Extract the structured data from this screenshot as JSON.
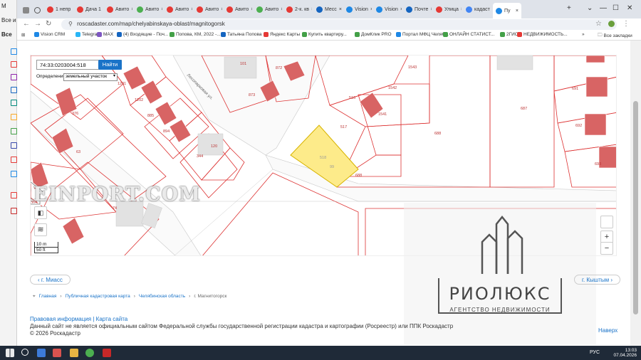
{
  "outer_window": {
    "items": [
      "M",
      "Все и",
      "Все"
    ]
  },
  "tabs": [
    {
      "label": "1 непр",
      "color": "#e53935"
    },
    {
      "label": "Дача 1",
      "color": "#e53935"
    },
    {
      "label": "Авито",
      "color": "#e53935"
    },
    {
      "label": "Авито",
      "color": "#4caf50"
    },
    {
      "label": "Авито",
      "color": "#e53935"
    },
    {
      "label": "Авито",
      "color": "#e53935"
    },
    {
      "label": "Авито",
      "color": "#e53935"
    },
    {
      "label": "Авито",
      "color": "#4caf50"
    },
    {
      "label": "2-к. кв",
      "color": "#e53935"
    },
    {
      "label": "Месс",
      "color": "#1565c0"
    },
    {
      "label": "Vision",
      "color": "#1e88e5"
    },
    {
      "label": "Vision",
      "color": "#1e88e5"
    },
    {
      "label": "Почте",
      "color": "#1565c0"
    },
    {
      "label": "Улица",
      "color": "#e53935"
    },
    {
      "label": "кадаст",
      "color": "#4285f4"
    },
    {
      "label": "Пу",
      "color": "#1e88e5"
    }
  ],
  "address_bar": {
    "url": "roscadaster.com/map/chelyabinskaya-oblast/magnitogorsk"
  },
  "bookmarks": [
    {
      "label": "Vision CRM",
      "color": "#1e88e5"
    },
    {
      "label": "Telegram",
      "color": "#29b6f6"
    },
    {
      "label": "MAX",
      "color": "#7e57c2"
    },
    {
      "label": "(4) Входящие - Поч...",
      "color": "#1565c0"
    },
    {
      "label": "Попова, КМ, 2022 -...",
      "color": "#43a047"
    },
    {
      "label": "Татьяна Попова",
      "color": "#1565c0"
    },
    {
      "label": "Яндекс Карты",
      "color": "#e53935"
    },
    {
      "label": "Купить квартиру...",
      "color": "#43a047"
    },
    {
      "label": "ДомКлик PRO",
      "color": "#43a047"
    },
    {
      "label": "Портал МФЦ Челяб...",
      "color": "#1e88e5"
    },
    {
      "label": "ОНЛАЙН СТАТИСТ...",
      "color": "#43a047"
    },
    {
      "label": "2ГИС",
      "color": "#43a047"
    },
    {
      "label": "НЕДВИЖИМОСТЬ...",
      "color": "#e53935"
    }
  ],
  "bookmarks_folder": "Все закладки",
  "map": {
    "search_value": "74:33:0203004:518",
    "find_label": "Найти",
    "mode_label": "Определение",
    "mode_value": "земельный участок",
    "zoom_in": "+",
    "zoom_out": "−",
    "scale_m": "10 m",
    "scale_ft": "50 ft",
    "street": "Лесопарковая ул.",
    "parcels": [
      "101",
      "872",
      "873",
      "1543",
      "1542",
      "516",
      "1541",
      "517",
      "687",
      "688",
      "691",
      "692",
      "693",
      "376",
      "1201",
      "1202",
      "885",
      "894",
      "344",
      "120",
      "63",
      "518",
      "99",
      "364",
      "74",
      "688"
    ],
    "watermark": "REINPORT.COM"
  },
  "pager": {
    "prev": "г. Миасс",
    "next": "г. Кыштым"
  },
  "breadcrumb": [
    "Главная",
    "Публичная кадастровая карта",
    "Челябинская область",
    "г. Магнитогорск"
  ],
  "footer": {
    "legal": "Правовая информация",
    "sep": " | ",
    "sitemap": "Карта сайта",
    "disclaimer": "Данный сайт не является официальным сайтом Федеральной службы государственной регистрации кадастра и картографии (Росреестр) или ППК Роскадастр",
    "copyright": "© 2026 Роскадастр",
    "up": "Наверх"
  },
  "logo": {
    "name": "РИОЛЮКС",
    "subtitle": "АГЕНТСТВО НЕДВИЖИМОСТИ"
  },
  "taskbar": {
    "lang": "РУС",
    "time": "13:03",
    "date": "07.04.2026"
  }
}
